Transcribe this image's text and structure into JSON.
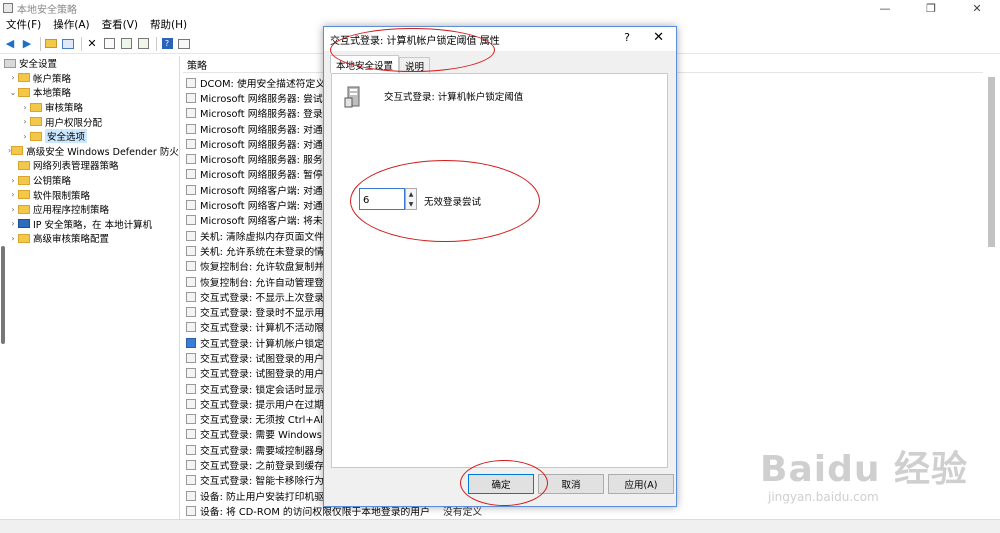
{
  "window": {
    "title": "本地安全策略",
    "controls": [
      "—",
      "❐",
      "✕"
    ]
  },
  "menu": [
    "文件(F)",
    "操作(A)",
    "查看(V)",
    "帮助(H)"
  ],
  "toolbar_icons": [
    "back-arrow-icon",
    "forward-arrow-icon",
    "up-folder-icon",
    "console-tree-icon",
    "delete-icon",
    "properties-icon",
    "refresh-icon",
    "export-list-icon",
    "help-icon",
    "show-hide-icon"
  ],
  "tree": {
    "root": "安全设置",
    "items": [
      {
        "label": "帐户策略",
        "level": 1,
        "expanded": false
      },
      {
        "label": "本地策略",
        "level": 1,
        "expanded": true
      },
      {
        "label": "审核策略",
        "level": 2,
        "expanded": false
      },
      {
        "label": "用户权限分配",
        "level": 2,
        "expanded": false
      },
      {
        "label": "安全选项",
        "level": 2,
        "expanded": false,
        "selected": true
      },
      {
        "label": "高级安全 Windows Defender 防火墙",
        "level": 1,
        "expanded": false
      },
      {
        "label": "网络列表管理器策略",
        "level": 1,
        "expanded": false
      },
      {
        "label": "公钥策略",
        "level": 1,
        "expanded": false
      },
      {
        "label": "软件限制策略",
        "level": 1,
        "expanded": false
      },
      {
        "label": "应用程序控制策略",
        "level": 1,
        "expanded": false
      },
      {
        "label": "IP 安全策略，在 本地计算机",
        "level": 1,
        "expanded": false
      },
      {
        "label": "高级审核策略配置",
        "level": 1,
        "expanded": false
      }
    ]
  },
  "list": {
    "column_policy": "策略",
    "rows": [
      {
        "text": "DCOM: 使用安全描述符定义语"
      },
      {
        "text": "Microsoft 网络服务器: 尝试使用"
      },
      {
        "text": "Microsoft 网络服务器: 登录时间"
      },
      {
        "text": "Microsoft 网络服务器: 对通信进"
      },
      {
        "text": "Microsoft 网络服务器: 对通信进"
      },
      {
        "text": "Microsoft 网络服务器: 服务器 S"
      },
      {
        "text": "Microsoft 网络服务器: 暂停会话"
      },
      {
        "text": "Microsoft 网络客户端: 对通信进"
      },
      {
        "text": "Microsoft 网络客户端: 对通信进"
      },
      {
        "text": "Microsoft 网络客户端: 将未加密"
      },
      {
        "text": "关机: 清除虚拟内存页面文件"
      },
      {
        "text": "关机: 允许系统在未登录的情况下"
      },
      {
        "text": "恢复控制台: 允许软盘复制并访问"
      },
      {
        "text": "恢复控制台: 允许自动管理登录"
      },
      {
        "text": "交互式登录: 不显示上次登录"
      },
      {
        "text": "交互式登录: 登录时不显示用户名"
      },
      {
        "text": "交互式登录: 计算机不活动限制"
      },
      {
        "text": "交互式登录: 计算机帐户锁定阈值",
        "selected": true
      },
      {
        "text": "交互式登录: 试图登录的用户的消"
      },
      {
        "text": "交互式登录: 试图登录的用户的消"
      },
      {
        "text": "交互式登录: 锁定会话时显示用户"
      },
      {
        "text": "交互式登录: 提示用户在过期之前"
      },
      {
        "text": "交互式登录: 无须按 Ctrl+Alt+D"
      },
      {
        "text": "交互式登录: 需要 Windows Hel"
      },
      {
        "text": "交互式登录: 需要域控制器身份验"
      },
      {
        "text": "交互式登录: 之前登录到缓存的次"
      },
      {
        "text": "交互式登录: 智能卡移除行为"
      },
      {
        "text": "设备: 防止用户安装打印机驱动程"
      },
      {
        "text": "设备: 将 CD-ROM 的访问权限仅限于本地登录的用户",
        "setting": "没有定义"
      }
    ]
  },
  "dialog": {
    "title": "交互式登录: 计算机帐户锁定阈值 属性",
    "help": "?",
    "close": "✕",
    "tabs": [
      "本地安全设置",
      "说明"
    ],
    "policy_name": "交互式登录: 计算机帐户锁定阈值",
    "threshold_value": "6",
    "threshold_label": "无效登录尝试",
    "ok": "确定",
    "cancel": "取消",
    "apply": "应用(A)"
  },
  "watermark": {
    "logo": "Baidu 经验",
    "url": "jingyan.baidu.com"
  },
  "colors": {
    "annotation": "#d11a1a",
    "selection": "#cce8ff",
    "folder": "#f2c74a",
    "accent": "#0078d7"
  }
}
